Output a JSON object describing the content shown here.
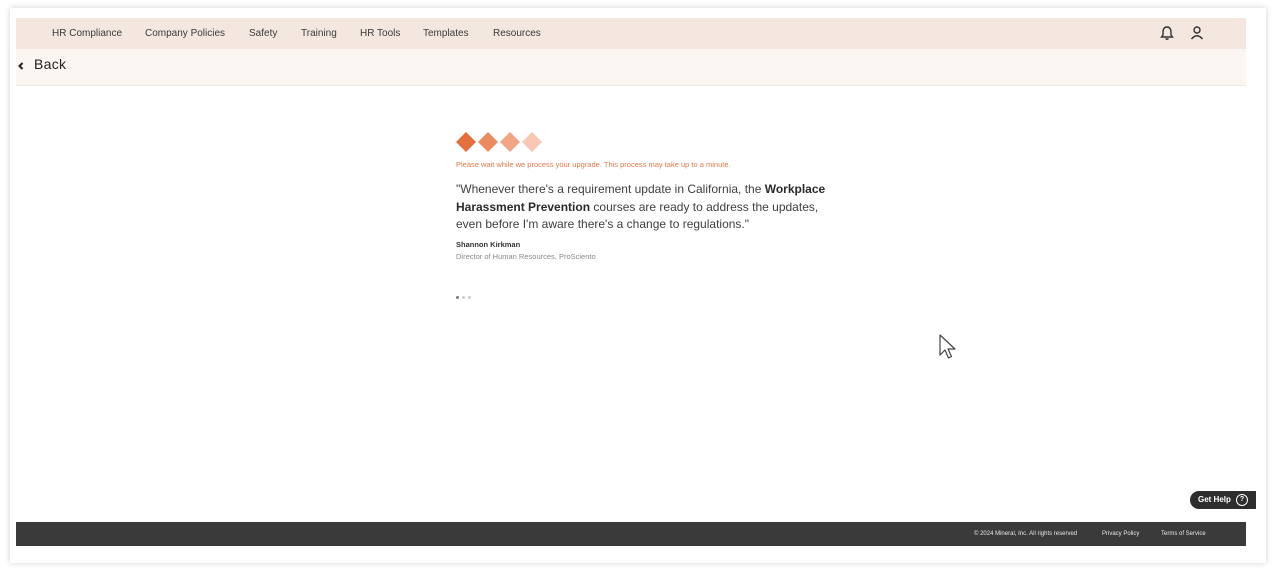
{
  "nav": {
    "items": [
      {
        "label": "HR Compliance"
      },
      {
        "label": "Company Policies"
      },
      {
        "label": "Safety"
      },
      {
        "label": "Training"
      },
      {
        "label": "HR Tools"
      },
      {
        "label": "Templates"
      },
      {
        "label": "Resources"
      }
    ],
    "icons": [
      "bell-icon",
      "user-icon"
    ]
  },
  "back": {
    "label": "Back"
  },
  "loading": {
    "notice": "Please wait while we process your upgrade. This process may take up to a minute.",
    "quote_part1": "\"Whenever there's a requirement update in California, the ",
    "quote_bold": "Workplace Harassment Prevention",
    "quote_part2": " courses are ready to address the updates, even before I'm aware there's a change to regulations.\"",
    "author": "Shannon Kirkman",
    "author_title": "Director of Human Resources, ProSciento"
  },
  "get_help": {
    "label": "Get Help",
    "icon_glyph": "?"
  },
  "footer": {
    "copyright": "© 2024 Mineral, Inc. All rights reserved",
    "privacy": "Privacy Policy",
    "terms": "Terms of Service"
  },
  "colors": {
    "nav_bg": "#f3e7df",
    "accent": "#e07a4c",
    "footer_bg": "#3a3a3a"
  }
}
